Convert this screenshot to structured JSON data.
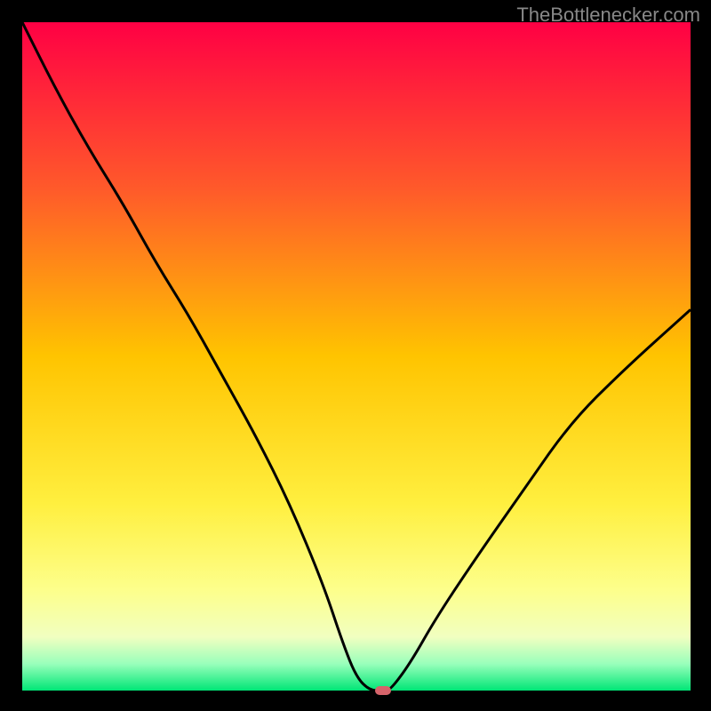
{
  "watermark": "TheBottlenecker.com",
  "chart_data": {
    "type": "line",
    "title": "",
    "xlabel": "",
    "ylabel": "",
    "xlim": [
      0,
      100
    ],
    "ylim": [
      0,
      100
    ],
    "background": {
      "type": "gradient",
      "stops": [
        {
          "pos": 0.0,
          "color": "#ff0044"
        },
        {
          "pos": 0.25,
          "color": "#ff5a2a"
        },
        {
          "pos": 0.5,
          "color": "#ffc400"
        },
        {
          "pos": 0.72,
          "color": "#ffef3f"
        },
        {
          "pos": 0.85,
          "color": "#fdff8c"
        },
        {
          "pos": 0.92,
          "color": "#f1ffc0"
        },
        {
          "pos": 0.96,
          "color": "#99ffbb"
        },
        {
          "pos": 1.0,
          "color": "#00e676"
        }
      ]
    },
    "series": [
      {
        "name": "curve",
        "x": [
          0,
          5,
          10,
          15,
          20,
          25,
          30,
          35,
          40,
          45,
          48,
          50,
          52,
          54,
          55,
          58,
          62,
          68,
          75,
          82,
          90,
          100
        ],
        "y": [
          100,
          90,
          81,
          73,
          64,
          56,
          47,
          38,
          28,
          16,
          7,
          2,
          0,
          0,
          0,
          4,
          11,
          20,
          30,
          40,
          48,
          57
        ]
      }
    ],
    "marker": {
      "x": 54,
      "y": 0,
      "color": "#d6636a"
    }
  }
}
